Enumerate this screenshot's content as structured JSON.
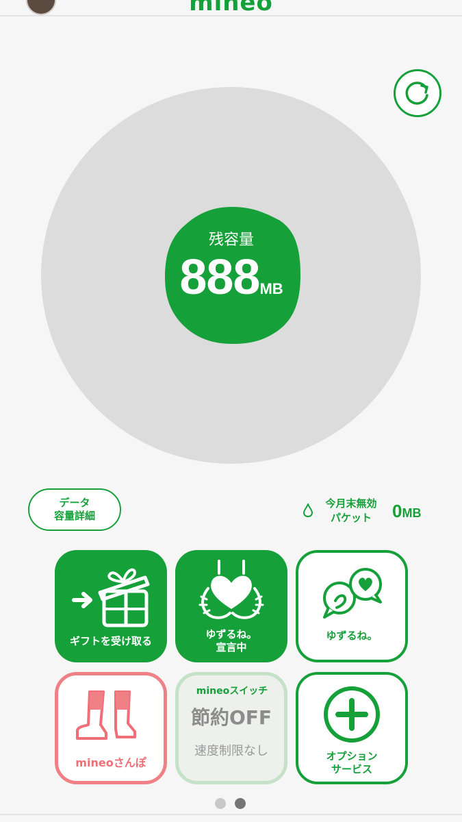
{
  "header": {
    "logo": "mineo"
  },
  "icons": {
    "refresh": "refresh-icon",
    "drop": "drop-icon"
  },
  "colors": {
    "brand_green": "#16a03a",
    "gauge_gray": "#dcdcdc",
    "pink": "#ef8086",
    "dot_inactive": "#c8c8c8",
    "dot_active": "#767676"
  },
  "gauge": {
    "label": "残容量",
    "value": "888",
    "unit": "MB"
  },
  "detail_button": {
    "line1": "データ",
    "line2": "容量詳細"
  },
  "invalid_packet": {
    "line1": "今月末無効",
    "line2": "パケット",
    "value": "0",
    "unit": "MB"
  },
  "tiles": [
    {
      "label": "ギフトを受け取る"
    },
    {
      "line1": "ゆずるね。",
      "line2": "宣言中"
    },
    {
      "label": "ゆずるね。"
    },
    {
      "label": "mineoさんぽ"
    },
    {
      "brand": "mineoスイッチ",
      "main": "節約OFF",
      "sub": "速度制限なし"
    },
    {
      "line1": "オプション",
      "line2": "サービス"
    }
  ],
  "pager": {
    "pages": 2,
    "current": 2
  }
}
